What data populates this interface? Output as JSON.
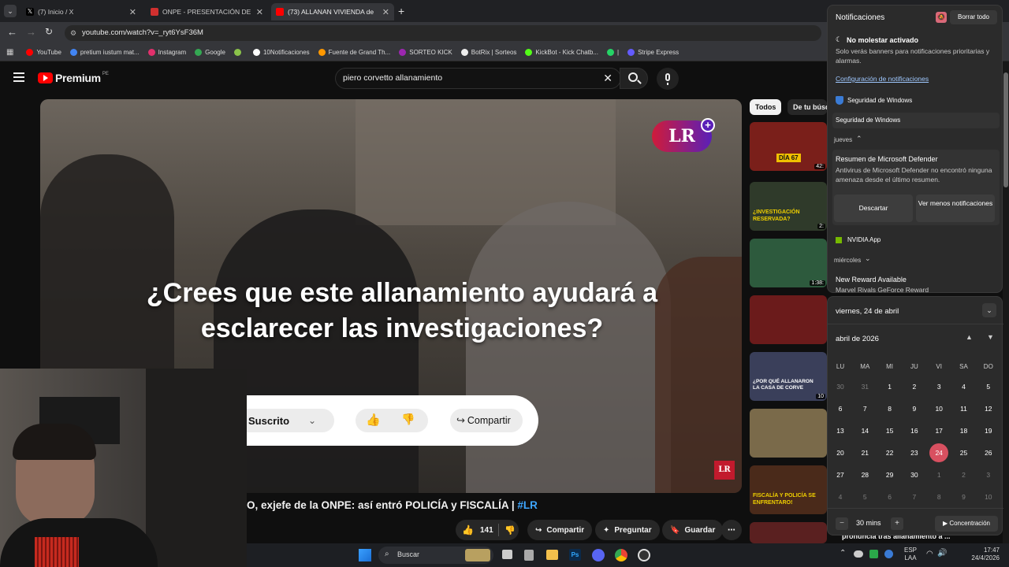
{
  "browser": {
    "tabs": [
      {
        "label": "(7) Inicio / X",
        "favicon_color": "#000000"
      },
      {
        "label": "ONPE - PRESENTACIÓN DE RES",
        "favicon_color": "#d0302f"
      },
      {
        "label": "(73) ALLANAN VIVIENDA de",
        "favicon_color": "#ff0000"
      }
    ],
    "url": "youtube.com/watch?v=_ryt6YsF36M",
    "bookmarks": [
      {
        "label": "YouTube",
        "color": "#ff0000"
      },
      {
        "label": "pretium iustum mat...",
        "color": "#4285f4"
      },
      {
        "label": "Instagram",
        "color": "#e1306c"
      },
      {
        "label": "Google",
        "color": "#34a853"
      },
      {
        "label": "",
        "color": "#8bc34a"
      },
      {
        "label": "10Notificaciones",
        "color": "#ffffff"
      },
      {
        "label": "Fuente de Grand Th...",
        "color": "#ff9800"
      },
      {
        "label": "SORTEO KICK",
        "color": "#9c27b0"
      },
      {
        "label": "BotRix | Sorteos",
        "color": "#eeeeee"
      },
      {
        "label": "KickBot - Kick Chatb...",
        "color": "#53fc18"
      },
      {
        "label": "|",
        "color": "#25d366"
      },
      {
        "label": "Stripe Express",
        "color": "#635bff"
      }
    ]
  },
  "youtube": {
    "logo": "Premium",
    "logo_region": "PE",
    "search_query": "piero corvetto allanamiento",
    "video": {
      "overlay_question": "¿Crees que este allanamiento ayudará a esclarecer las investigaciones?",
      "badge": "LR",
      "corner_badge": "LR",
      "subscribe_card": {
        "subscribed": "Suscrito",
        "share": "Compartir"
      },
      "title_prefix": "O, exjefe de la ONPE: así entró POLICÍA y FISCALÍA | ",
      "title_hashtag": "#LR"
    },
    "actions": {
      "likes": "141",
      "share": "Compartir",
      "ask": "Preguntar",
      "save": "Guardar"
    },
    "chips": [
      "Todos",
      "De tu búsq"
    ],
    "thumbnails": [
      {
        "caption": "DÍA 67",
        "duration": "42:",
        "color": "#7a1f1a"
      },
      {
        "caption": "¿INVESTIGACIÓN RESERVADA?",
        "duration": "2:",
        "color": "#2f3a2a"
      },
      {
        "caption": "",
        "duration": "1:38:",
        "color": "#2d5a3d"
      },
      {
        "caption": "",
        "duration": "",
        "color": "#6b1b1b"
      },
      {
        "caption": "¿POR QUÉ ALLANARON LA CASA DE CORVE",
        "duration": "10",
        "color": "#3a3f5a"
      },
      {
        "caption": "",
        "duration": "",
        "color": "#7a6a4a"
      },
      {
        "caption": "FISCALÍA Y POLICÍA SE ENFRENTARO!",
        "duration": "",
        "color": "#4a2a1a"
      },
      {
        "caption": "",
        "duration": "",
        "color": "#5a2020"
      }
    ],
    "sidebar_last_title": "pronuncia tras allanamiento a ..."
  },
  "notifications": {
    "title": "Notificaciones",
    "clear_all": "Borrar todo",
    "dnd_title": "No molestar activado",
    "dnd_text": "Solo verás banners para notificaciones prioritarias y alarmas.",
    "settings_link": "Configuración de notificaciones",
    "app_security": "Seguridad de Windows",
    "security_row": "Seguridad de Windows",
    "group_thursday": "jueves",
    "defender_title": "Resumen de Microsoft Defender",
    "defender_text": "Antivirus de Microsoft Defender no encontró ninguna amenaza desde el último resumen.",
    "btn_dismiss": "Descartar",
    "btn_less": "Ver menos notificaciones",
    "app_nvidia": "NVIDIA App",
    "group_wednesday": "miércoles",
    "reward_title": "New Reward Available",
    "reward_sub": "Marvel Rivals GeForce Reward"
  },
  "calendar": {
    "date_header": "viernes, 24 de abril",
    "month": "abril de 2026",
    "weekdays": [
      "LU",
      "MA",
      "MI",
      "JU",
      "VI",
      "SA",
      "DO"
    ],
    "days": [
      [
        "30",
        "31",
        "1",
        "2",
        "3",
        "4",
        "5"
      ],
      [
        "6",
        "7",
        "8",
        "9",
        "10",
        "11",
        "12"
      ],
      [
        "13",
        "14",
        "15",
        "16",
        "17",
        "18",
        "19"
      ],
      [
        "20",
        "21",
        "22",
        "23",
        "24",
        "25",
        "26"
      ],
      [
        "27",
        "28",
        "29",
        "30",
        "1",
        "2",
        "3"
      ],
      [
        "4",
        "5",
        "6",
        "7",
        "8",
        "9",
        "10"
      ]
    ],
    "today": "24",
    "focus_minutes": "30 mins",
    "focus_button": "Concentración"
  },
  "taskbar": {
    "search": "Buscar",
    "lang": "ESP",
    "lang_sub": "LAA",
    "time": "17:47",
    "date": "24/4/2026"
  }
}
